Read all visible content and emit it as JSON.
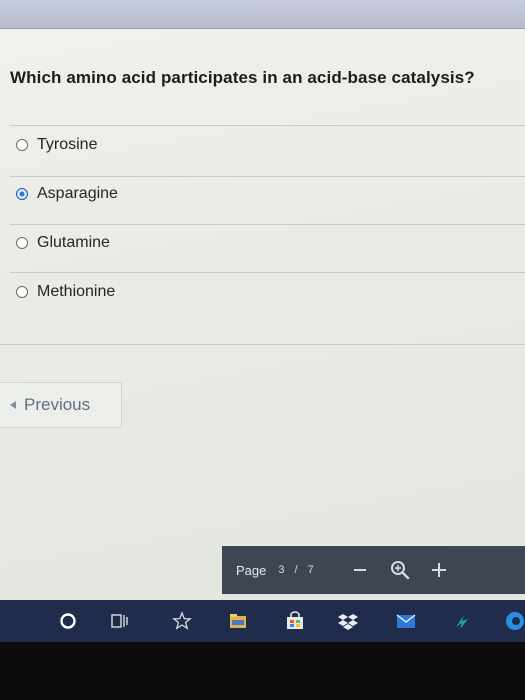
{
  "question": {
    "text": "Which amino acid participates in an acid-base catalysis?"
  },
  "options": [
    {
      "label": "Tyrosine",
      "selected": false
    },
    {
      "label": "Asparagine",
      "selected": true
    },
    {
      "label": "Glutamine",
      "selected": false
    },
    {
      "label": "Methionine",
      "selected": false
    }
  ],
  "navigation": {
    "previous_label": "Previous"
  },
  "pdf_toolbar": {
    "page_label": "Page",
    "current_page": "3",
    "separator": "/",
    "total_pages": "7"
  },
  "icons": {
    "prev": "chevron-left-icon",
    "zoom_out": "minus-icon",
    "zoom": "magnifier-icon",
    "zoom_in": "plus-icon",
    "taskbar": [
      "cortana-circle-icon",
      "task-view-icon",
      "star-icon",
      "file-explorer-icon",
      "store-icon",
      "dropbox-icon",
      "mail-icon",
      "app-icon",
      "edge-icon"
    ]
  },
  "colors": {
    "selected_radio": "#2f76df",
    "toolbar_bg": "#3f4552",
    "taskbar_bg": "#1f2c4c",
    "prev_text": "#5d7186"
  }
}
